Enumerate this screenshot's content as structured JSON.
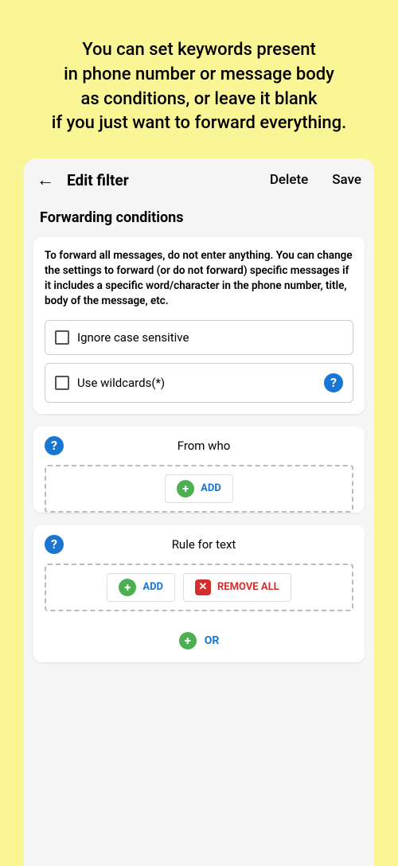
{
  "promo": {
    "line1": "You can set keywords present",
    "line2": "in phone number or message body",
    "line3": "as conditions, or leave it blank",
    "line4": "if you just want to forward everything."
  },
  "header": {
    "title": "Edit filter",
    "delete": "Delete",
    "save": "Save"
  },
  "section": {
    "title": "Forwarding conditions",
    "description": "To forward all messages, do not enter anything. You can change the settings to forward (or do not forward) specific messages if it includes a specific word/character in the phone number, title, body of the message, etc."
  },
  "checkboxes": {
    "ignoreCase": "Ignore case sensitive",
    "wildcards": "Use wildcards(*)"
  },
  "rules": {
    "fromWho": "From who",
    "ruleForText": "Rule for text"
  },
  "buttons": {
    "add": "ADD",
    "removeAll": "REMOVE ALL",
    "or": "OR"
  }
}
